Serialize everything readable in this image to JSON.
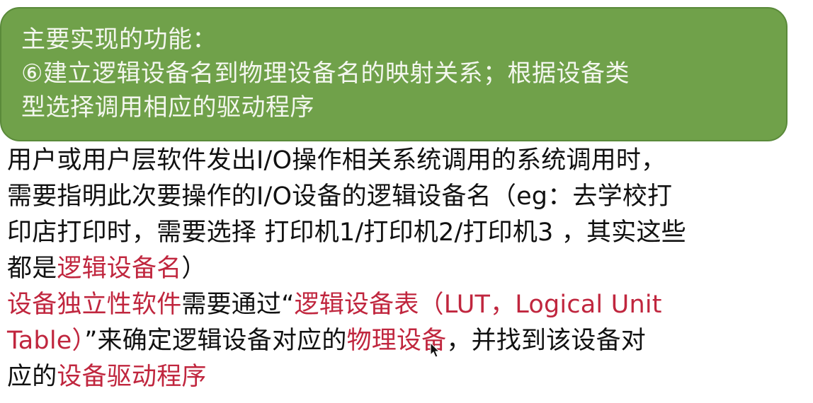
{
  "box": {
    "heading": "主要实现的功能：",
    "item_line1": "⑥建立逻辑设备名到物理设备名的映射关系；根据设备类",
    "item_line2": "型选择调用相应的驱动程序"
  },
  "body": {
    "l1": "用户或用户层软件发出I/O操作相关系统调用的系统调用时，",
    "l2": "需要指明此次要操作的I/O设备的逻辑设备名（eg：去学校打",
    "l3": "印店打印时，需要选择 打印机1/打印机2/打印机3 ，其实这些",
    "l4_a": "都是",
    "l4_red": "逻辑设备名",
    "l4_b": "）",
    "l5_red1": "设备独立性软件",
    "l5_b": "需要通过“",
    "l5_red2": "逻辑设备表（LUT，Logical Unit",
    "l6_red1": "Table）",
    "l6_b": "”来确定逻辑设备对应的",
    "l6_red2": "物理设备",
    "l6_c": "，并找到该设备对",
    "l7_a": "应的",
    "l7_red": "设备驱动程序"
  },
  "colors": {
    "box_fill": "#70a14a",
    "highlight_red": "#c0263e"
  },
  "icons": {
    "cursor": "mouse-pointer-icon"
  }
}
